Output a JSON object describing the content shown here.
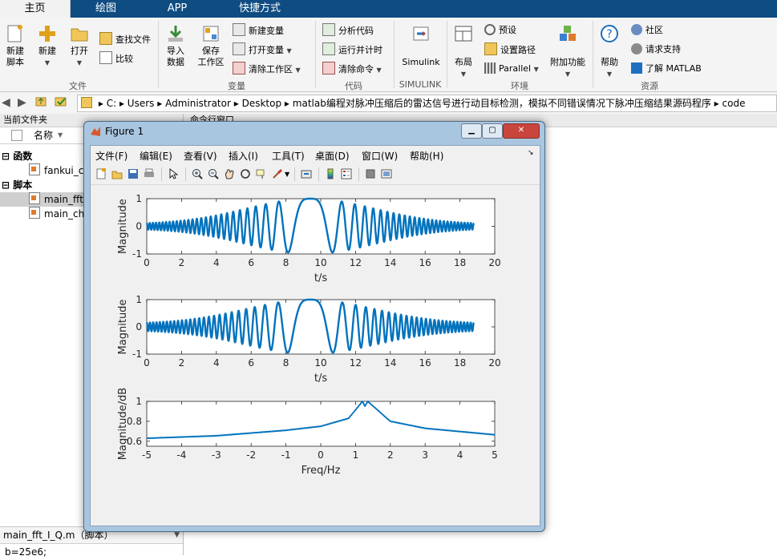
{
  "tabs": [
    {
      "label": "主页",
      "active": true
    },
    {
      "label": "绘图",
      "active": false
    },
    {
      "label": "APP",
      "active": false
    },
    {
      "label": "快捷方式",
      "active": false
    }
  ],
  "ribbon": {
    "file": {
      "group_label": "文件",
      "new_script": "新建\n脚本",
      "new": "新建",
      "open": "打开",
      "find_files": "查找文件",
      "compare": "比较"
    },
    "variable": {
      "group_label": "变量",
      "import_data": "导入\n数据",
      "save_workspace": "保存\n工作区",
      "new_variable": "新建变量",
      "open_variable": "打开变量",
      "clear_workspace": "清除工作区"
    },
    "code": {
      "group_label": "代码",
      "analyze_code": "分析代码",
      "run_and_time": "运行并计时",
      "clear_commands": "清除命令"
    },
    "simulink": {
      "group_label": "SIMULINK",
      "simulink": "Simulink"
    },
    "environment": {
      "group_label": "环境",
      "layout": "布局",
      "preferences": "预设",
      "set_path": "设置路径",
      "parallel": "Parallel",
      "addons": "附加功能"
    },
    "resources": {
      "group_label": "资源",
      "help": "帮助",
      "community": "社区",
      "request_support": "请求支持",
      "learn_matlab": "了解 MATLAB"
    }
  },
  "address": {
    "segments": [
      "C:",
      "Users",
      "Administrator",
      "Desktop",
      "matlab编程对脉冲压缩后的雷达信号进行动目标检测，模拟不同错误情况下脉冲压缩结果源码程序",
      "code"
    ]
  },
  "current_folder": {
    "title": "当前文件夹",
    "column_name": "名称",
    "groups": [
      {
        "label": "函数",
        "files": [
          "fankui_ca"
        ]
      },
      {
        "label": "脚本",
        "files": [
          "main_fft_",
          "main_chi"
        ]
      }
    ],
    "detail_label": "main_fft_I_Q.m（脚本）",
    "detail_code": "b=25e6;"
  },
  "command_window": {
    "title": "命令行窗口"
  },
  "figure": {
    "title": "Figure 1",
    "menu": [
      "文件(F)",
      "编辑(E)",
      "查看(V)",
      "插入(I)",
      "工具(T)",
      "桌面(D)",
      "窗口(W)",
      "帮助(H)"
    ],
    "toolbar_icons": [
      "new-figure-icon",
      "open-file-icon",
      "save-icon",
      "print-icon",
      "pointer-icon",
      "zoom-in-icon",
      "zoom-out-icon",
      "pan-icon",
      "rotate-icon",
      "data-cursor-icon",
      "brush-icon",
      "link-icon",
      "colorbar-icon",
      "legend-icon",
      "hide-plot-tools-icon",
      "show-plot-tools-icon"
    ]
  },
  "chart_data": [
    {
      "type": "line",
      "xlabel": "t/s",
      "ylabel": "Magnitude",
      "xlim": [
        0,
        20
      ],
      "ylim": [
        -1,
        1
      ],
      "xticks": [
        0,
        2,
        4,
        6,
        8,
        10,
        12,
        14,
        16,
        18,
        20
      ],
      "yticks": [
        -1,
        0,
        1
      ],
      "x_range": [
        0,
        18.8
      ],
      "signal": "chirp",
      "center": 9.4,
      "peak_amplitude": 1,
      "edge_amplitude": 0.08,
      "cycles": 27,
      "color": "#0072bd"
    },
    {
      "type": "line",
      "xlabel": "t/s",
      "ylabel": "Magnitude",
      "xlim": [
        0,
        20
      ],
      "ylim": [
        -1,
        1
      ],
      "xticks": [
        0,
        2,
        4,
        6,
        8,
        10,
        12,
        14,
        16,
        18,
        20
      ],
      "yticks": [
        -1,
        0,
        1
      ],
      "x_range": [
        0,
        18.8
      ],
      "signal": "chirp",
      "center": 9.4,
      "peak_amplitude": 1,
      "edge_amplitude": 0.12,
      "cycles": 26,
      "color": "#0072bd"
    },
    {
      "type": "line",
      "xlabel": "Freq/Hz",
      "ylabel": "Magnitude/dB",
      "xlim": [
        -5,
        5
      ],
      "ylim": [
        0.55,
        1
      ],
      "xticks": [
        -5,
        -4,
        -3,
        -2,
        -1,
        0,
        1,
        2,
        3,
        4,
        5
      ],
      "yticks": [
        0.6,
        0.8,
        1
      ],
      "ytick_labels": [
        "0.6",
        "0.8",
        "1"
      ],
      "peaks": [
        1.2,
        1.35
      ],
      "dip": 1.27,
      "values_at": {
        "-5": 0.63,
        "-3": 0.655,
        "-1": 0.71,
        "0": 0.75,
        "0.8": 0.83,
        "1.2": 1.0,
        "1.27": 0.95,
        "1.35": 1.0,
        "2": 0.8,
        "3": 0.73,
        "5": 0.665
      },
      "color": "#0072bd"
    }
  ]
}
